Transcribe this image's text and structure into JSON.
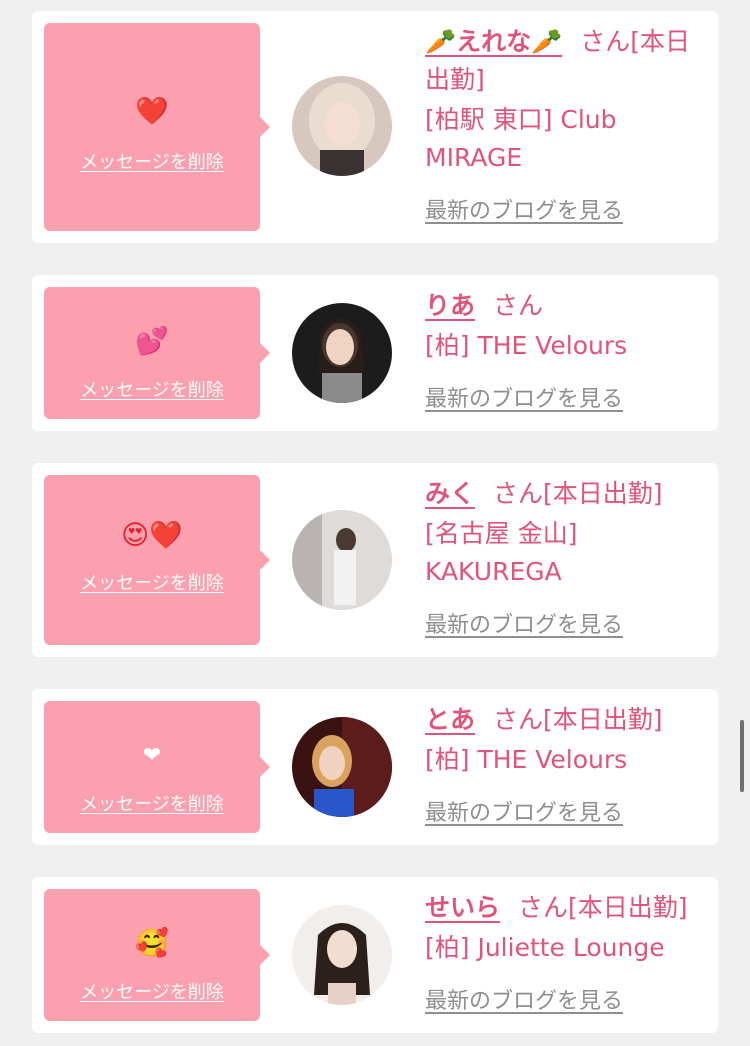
{
  "messages": [
    {
      "emoji": "❤️",
      "emoji_icon": "red-heart",
      "delete_label": "メッセージを削除",
      "name": "🥕えれな🥕",
      "honorific": "さん[本日出勤]",
      "shop": "[柏駅 東口] Club MIRAGE",
      "blog_label": "最新のブログを見る"
    },
    {
      "emoji": "💕",
      "emoji_icon": "two-hearts",
      "delete_label": "メッセージを削除",
      "name": "りあ",
      "honorific": "さん",
      "shop": "[柏] THE Velours",
      "blog_label": "最新のブログを見る"
    },
    {
      "emoji": "😍❤️",
      "emoji_icon": "heart-eyes-and-red-heart",
      "delete_label": "メッセージを削除",
      "name": "みく",
      "honorific": "さん[本日出勤]",
      "shop": "[名古屋 金山] KAKUREGA",
      "blog_label": "最新のブログを見る"
    },
    {
      "emoji": "❤",
      "emoji_icon": "white-heart",
      "delete_label": "メッセージを削除",
      "name": "とあ",
      "honorific": "さん[本日出勤]",
      "shop": "[柏] THE Velours",
      "blog_label": "最新のブログを見る"
    },
    {
      "emoji": "🥰",
      "emoji_icon": "smiling-face-with-hearts",
      "delete_label": "メッセージを削除",
      "name": "せいら",
      "honorific": "さん[本日出勤]",
      "shop": "[柏] Juliette Lounge",
      "blog_label": "最新のブログを見る"
    }
  ],
  "colors": {
    "accent_pink": "#e0547b",
    "message_bg": "#fc9fae",
    "card_bg": "#ffffff",
    "page_bg": "#f0f0f0",
    "link_gray": "#8e8e8e"
  }
}
